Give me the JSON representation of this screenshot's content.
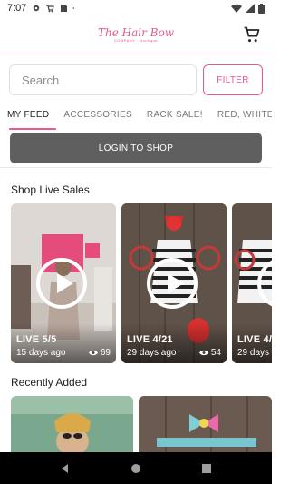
{
  "status_bar": {
    "time": "7:07",
    "left_icons": [
      "gear-icon",
      "cart-notification-icon",
      "sd-card-icon",
      "dot-icon"
    ],
    "right_icons": [
      "wifi-icon",
      "signal-icon",
      "battery-icon"
    ]
  },
  "header": {
    "logo_text": "The Hair Bow",
    "logo_subtext": "COMPANY · Boutique",
    "cart_icon": "cart-icon"
  },
  "search": {
    "placeholder": "Search",
    "filter_label": "FILTER"
  },
  "tabs": [
    {
      "label": "MY FEED",
      "active": true
    },
    {
      "label": "ACCESSORIES",
      "active": false
    },
    {
      "label": "RACK SALE!",
      "active": false
    },
    {
      "label": "RED, WHITE & BLUE",
      "active": false
    }
  ],
  "login": {
    "label": "LOGIN TO SHOP"
  },
  "live_section": {
    "title": "Shop Live Sales",
    "cards": [
      {
        "label": "LIVE 5/5",
        "date": "15 days ago",
        "views": "69"
      },
      {
        "label": "LIVE 4/21",
        "date": "29 days ago",
        "views": "54"
      },
      {
        "label": "LIVE 4/",
        "date": "29 days a",
        "views": ""
      }
    ]
  },
  "recent_section": {
    "title": "Recently Added"
  },
  "nav": {
    "back_icon": "back-icon",
    "home_icon": "home-icon",
    "recents_icon": "recents-icon"
  },
  "colors": {
    "accent": "#e8578e",
    "login_button": "#5f5f5f",
    "nav_bar": "#000000"
  }
}
